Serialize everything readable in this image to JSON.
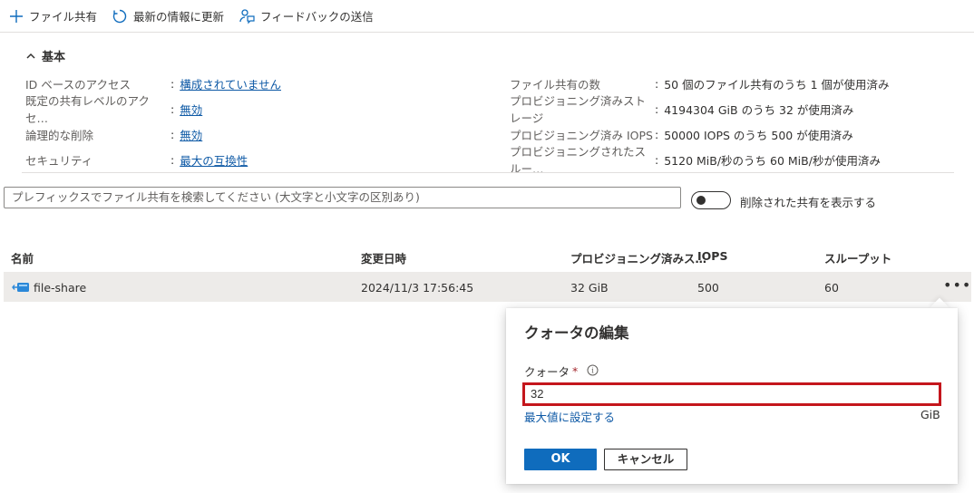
{
  "toolbar": {
    "add_share": "ファイル共有",
    "refresh": "最新の情報に更新",
    "feedback": "フィードバックの送信"
  },
  "essentials": {
    "header": "基本",
    "left": [
      {
        "label": "ID ベースのアクセス",
        "value": "構成されていません",
        "link": true
      },
      {
        "label": "既定の共有レベルのアクセ…",
        "value": "無効",
        "link": true
      },
      {
        "label": "論理的な削除",
        "value": "無効",
        "link": true
      },
      {
        "label": "セキュリティ",
        "value": "最大の互換性",
        "link": true
      }
    ],
    "right": [
      {
        "label": "ファイル共有の数",
        "value": "50 個のファイル共有のうち 1 個が使用済み"
      },
      {
        "label": "プロビジョニング済みストレージ",
        "value": "4194304 GiB のうち 32 が使用済み"
      },
      {
        "label": "プロビジョニング済み IOPS",
        "value": "50000 IOPS のうち 500 が使用済み"
      },
      {
        "label": "プロビジョニングされたスルー…",
        "value": "5120 MiB/秒のうち 60 MiB/秒が使用済み"
      }
    ],
    "colon": ":"
  },
  "search": {
    "placeholder": "プレフィックスでファイル共有を検索してください (大文字と小文字の区別あり)"
  },
  "toggle": {
    "label": "削除された共有を表示する",
    "on": false
  },
  "table": {
    "columns": [
      "名前",
      "変更日時",
      "プロビジョニング済みス…",
      "IOPS",
      "スループット"
    ],
    "rows": [
      {
        "name": "file-share",
        "modified": "2024/11/3 17:56:45",
        "provisioned": "32 GiB",
        "iops": "500",
        "throughput": "60"
      }
    ],
    "more": "•••"
  },
  "quota_panel": {
    "title": "クォータの編集",
    "label": "クォータ",
    "required_mark": "*",
    "info": "i",
    "value": "32",
    "max_link": "最大値に設定する",
    "unit": "GiB",
    "ok": "OK",
    "cancel": "キャンセル"
  },
  "colors": {
    "accent": "#0f6cbd",
    "link": "#0f5aa6",
    "highlight_border": "#c4161c",
    "row_selected": "#edebe9"
  }
}
